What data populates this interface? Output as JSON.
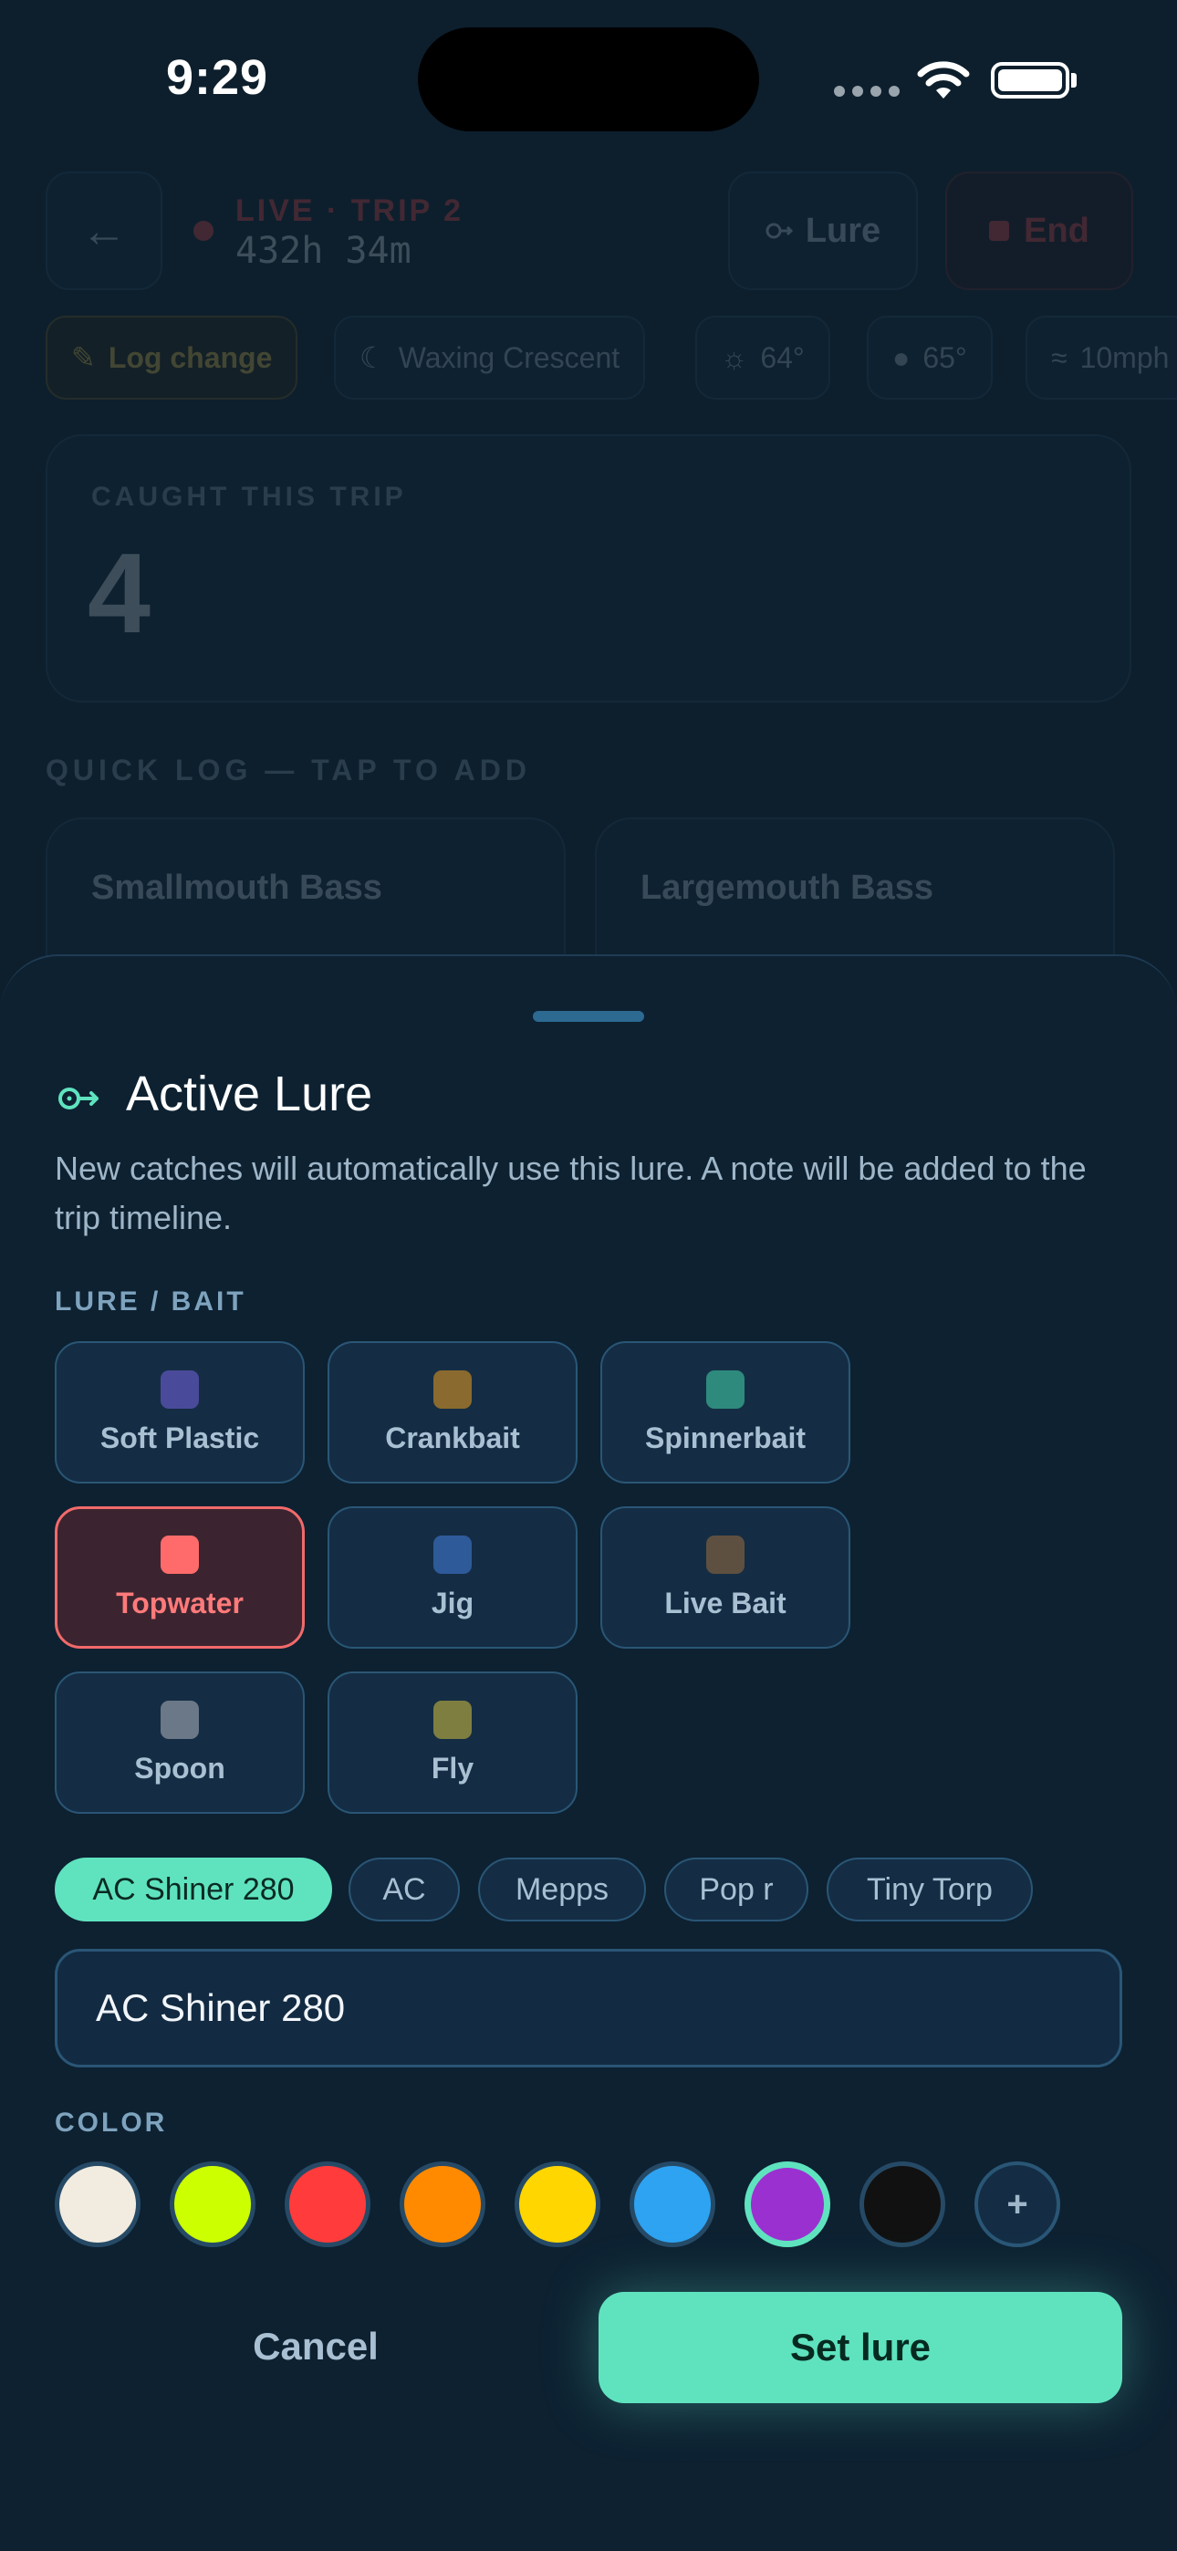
{
  "status_bar": {
    "time": "9:29"
  },
  "background": {
    "live_label": "LIVE · TRIP 2",
    "elapsed": "432h 34m",
    "lure_button": "Lure",
    "end_button": "End",
    "chips": [
      {
        "label": "Log change",
        "icon": "edit-icon"
      },
      {
        "label": "Waxing Crescent",
        "icon": "moon-icon"
      },
      {
        "label": "64°",
        "icon": "sun-icon"
      },
      {
        "label": "65°",
        "icon": "water-drop-icon"
      },
      {
        "label": "10mph",
        "icon": "wind-icon"
      }
    ],
    "caught_label": "CAUGHT THIS TRIP",
    "caught_value": "4",
    "quick_log_title": "QUICK LOG — TAP TO ADD",
    "species": [
      "Smallmouth Bass",
      "Largemouth Bass"
    ]
  },
  "sheet": {
    "title": "Active Lure",
    "description": "New catches will automatically use this lure. A note will be added to the trip timeline.",
    "lure_section_label": "LURE / BAIT",
    "lure_types": [
      {
        "label": "Soft Plastic",
        "color": "#4a4a9a",
        "selected": false
      },
      {
        "label": "Crankbait",
        "color": "#8a6a2e",
        "selected": false
      },
      {
        "label": "Spinnerbait",
        "color": "#2e8a7c",
        "selected": false
      },
      {
        "label": "Topwater",
        "color": "#ff6b6b",
        "selected": true
      },
      {
        "label": "Jig",
        "color": "#2e5a9a",
        "selected": false
      },
      {
        "label": "Live Bait",
        "color": "#5e5040",
        "selected": false
      },
      {
        "label": "Spoon",
        "color": "#6a7888",
        "selected": false
      },
      {
        "label": "Fly",
        "color": "#7e7e40",
        "selected": false
      }
    ],
    "recent_names": [
      {
        "label": "AC Shiner 280",
        "selected": true
      },
      {
        "label": "AC",
        "selected": false
      },
      {
        "label": "Mepps",
        "selected": false
      },
      {
        "label": "Pop r",
        "selected": false
      },
      {
        "label": "Tiny Torp",
        "selected": false
      }
    ],
    "lure_name_value": "AC Shiner 280",
    "color_section_label": "COLOR",
    "colors": [
      {
        "name": "white",
        "hex": "#f2ece0",
        "selected": false
      },
      {
        "name": "chartreuse",
        "hex": "#ccff00",
        "selected": false
      },
      {
        "name": "red",
        "hex": "#ff3b3b",
        "selected": false
      },
      {
        "name": "orange",
        "hex": "#ff8a00",
        "selected": false
      },
      {
        "name": "yellow",
        "hex": "#ffd600",
        "selected": false
      },
      {
        "name": "blue",
        "hex": "#2ea3f2",
        "selected": false
      },
      {
        "name": "purple",
        "hex": "#9b30d0",
        "selected": true
      },
      {
        "name": "black",
        "hex": "#111111",
        "selected": false
      }
    ],
    "add_color_label": "+",
    "cancel_label": "Cancel",
    "confirm_label": "Set lure"
  }
}
